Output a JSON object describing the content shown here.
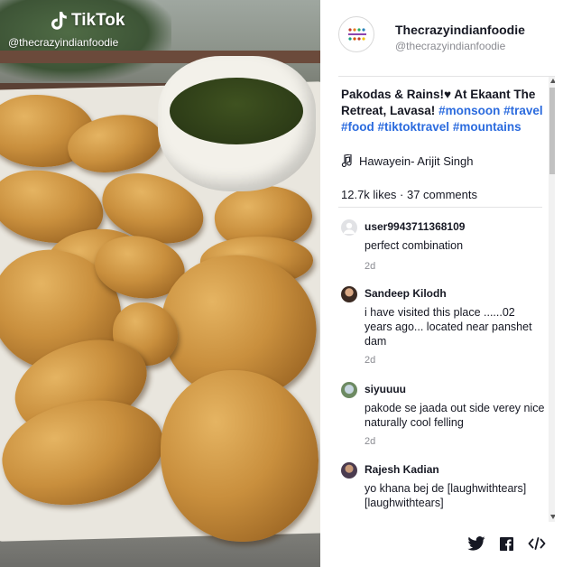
{
  "video": {
    "brand": "TikTok",
    "handle": "@thecrazyindianfoodie"
  },
  "author": {
    "name": "Thecrazyindianfoodie",
    "handle": "@thecrazyindianfoodie"
  },
  "post": {
    "caption_text": "Pakodas & Rains!♥ At Ekaant The Retreat, Lavasa!",
    "hashtags": [
      "#monsoon",
      "#travel",
      "#food",
      "#tiktoktravel",
      "#mountains"
    ],
    "sound": "Hawayein- Arijit Singh",
    "stats": "12.7k likes · 37 comments"
  },
  "comments": [
    {
      "user": "user9943711368109",
      "text": "perfect combination",
      "time": "2d",
      "avatar": "default-avatar-icon"
    },
    {
      "user": "Sandeep Kilodh",
      "text": "i have visited this place ......02 years ago... located near panshet dam",
      "time": "2d",
      "avatar": "user-photo"
    },
    {
      "user": "siyuuuu",
      "text": "pakode se jaada out side verey nice naturally cool felling",
      "time": "2d",
      "avatar": "user-photo"
    },
    {
      "user": "Rajesh Kadian",
      "text": "yo khana bej de [laughwithtears] [laughwithtears]",
      "time": "2d",
      "avatar": "user-photo"
    }
  ],
  "share": [
    "twitter-icon",
    "facebook-icon",
    "embed-code-icon"
  ],
  "colors": {
    "hashtag": "#2b6bde",
    "muted_text": "#8a8b91",
    "text": "#161823"
  }
}
